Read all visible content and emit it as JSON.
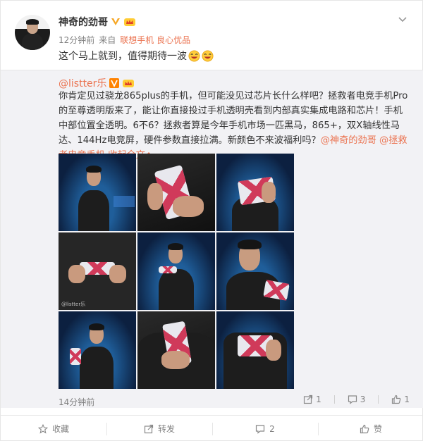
{
  "post": {
    "author": "神奇的劲哥",
    "time": "12分钟前",
    "source_prefix": "来自",
    "source": "联想手机 良心优品",
    "text": "这个马上就到，值得期待一波"
  },
  "repost": {
    "author": "@listter乐",
    "text_main": "你肯定见过骁龙865plus的手机，但可能没见过芯片长什么样吧？拯救者电竞手机Pro的至尊透明版来了，能让你直接投过手机透明壳看到内部真实集成电路和芯片！手机中部位置全透明。6不6？拯救者算是今年手机市场一匹黑马，865+，双X轴线性马达、144Hz电竞屏，硬件参数直接拉满。新颜色不来波福利吗？",
    "mention1": "@神奇的劲哥",
    "mention2": "@拯救者电竞手机",
    "fold": "收起全文",
    "time": "14分钟前",
    "share_count": "1",
    "comment_count": "3",
    "like_count": "1",
    "watermark": "@listter乐"
  },
  "footer": {
    "favorite": "收藏",
    "forward": "转发",
    "comment_count": "2",
    "like": "赞"
  },
  "colors": {
    "accent": "#eb7350",
    "muted": "#808080",
    "repost_bg": "#f2f2f5"
  },
  "icons": [
    "chevron-down-icon",
    "verified-v-icon",
    "crown-badge-icon",
    "laughing-emoji-icon",
    "share-icon",
    "comment-icon",
    "like-icon",
    "favorite-star-icon",
    "forward-icon"
  ]
}
